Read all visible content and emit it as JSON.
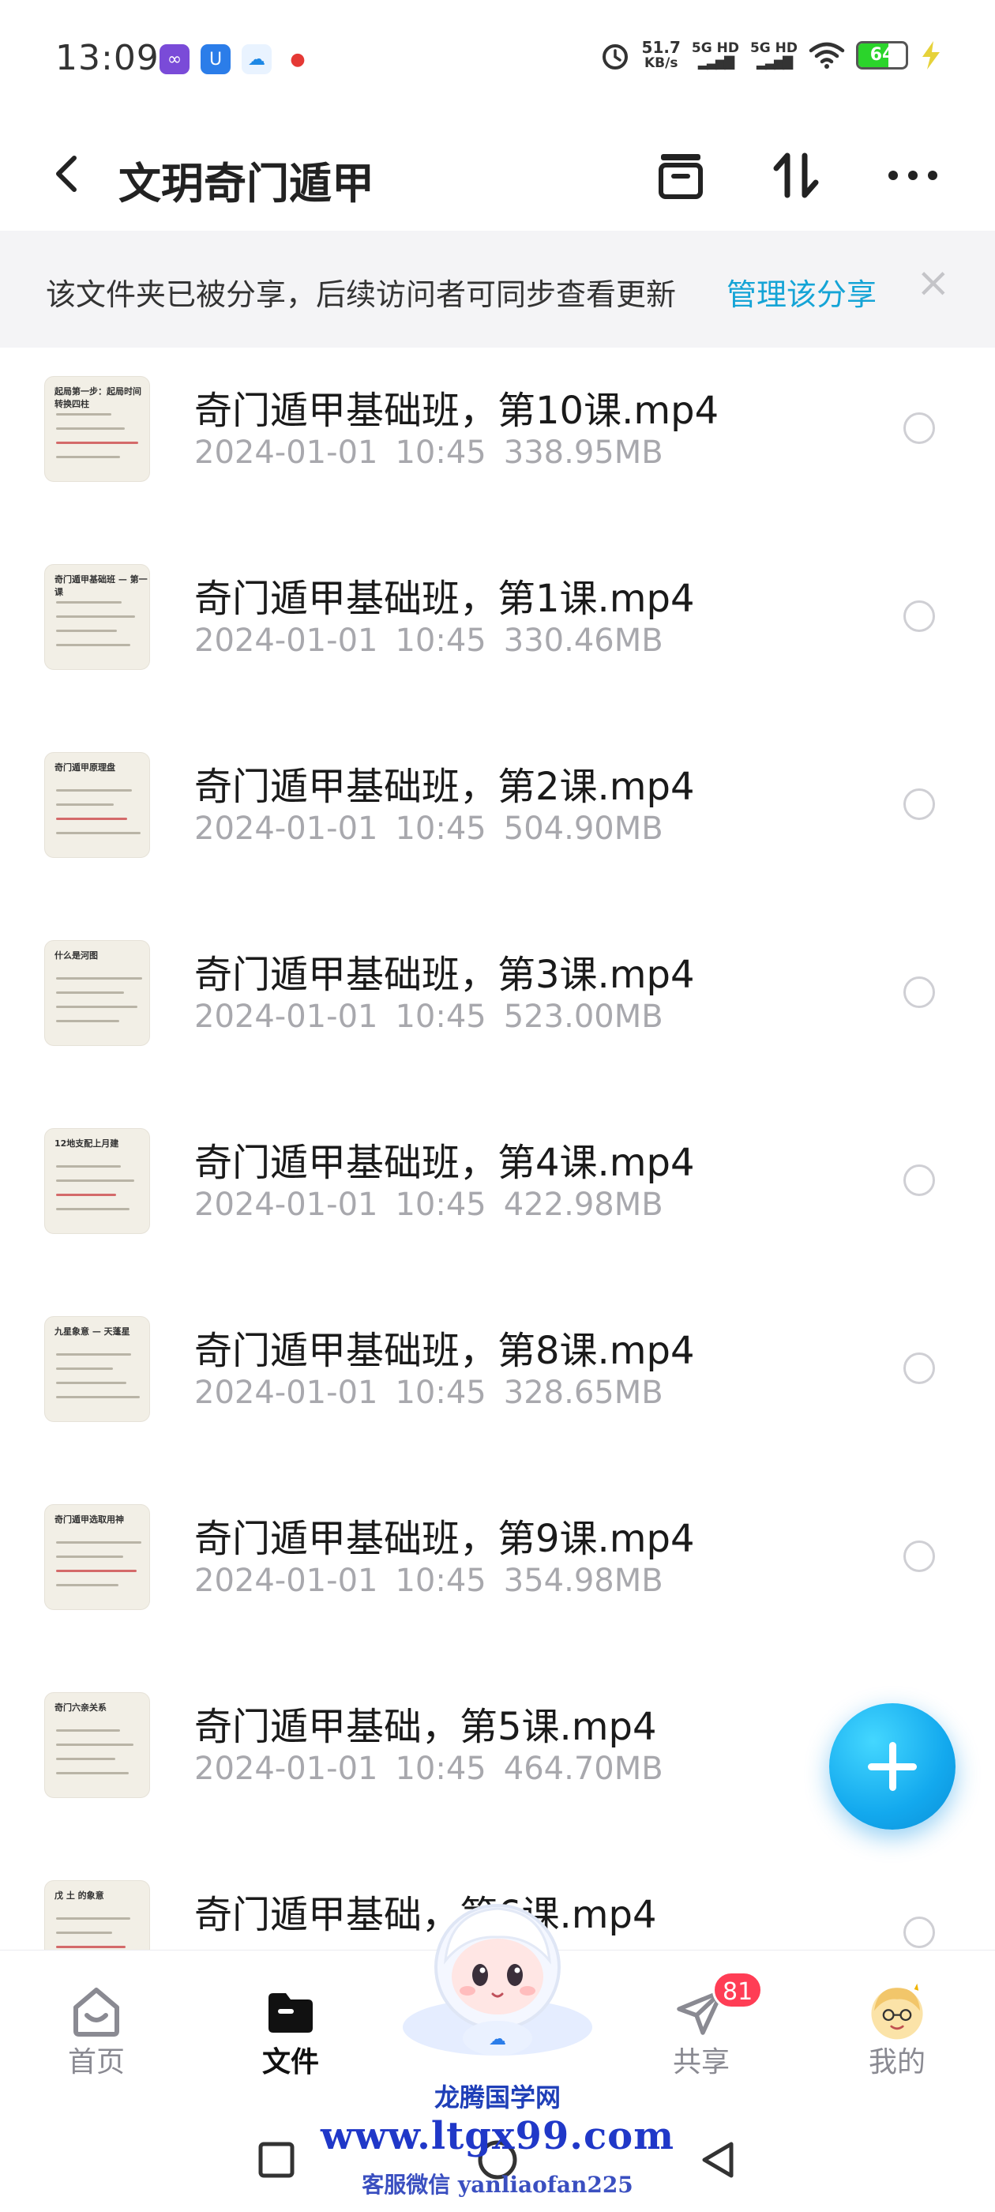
{
  "status_bar": {
    "time": "13:09",
    "net_speed_value": "51.7",
    "net_speed_unit": "KB/s",
    "signal_1": "5G HD",
    "signal_2": "5G HD",
    "battery": "64",
    "app_icons": [
      "infinity-app-icon",
      "shield-app-icon",
      "baidu-netdisk-icon",
      "map-pin-app-icon"
    ]
  },
  "header": {
    "title": "文玥奇门遁甲",
    "icons": [
      "back-icon",
      "archive-icon",
      "sort-icon",
      "more-icon"
    ]
  },
  "share_banner": {
    "text": "该文件夹已被分享，后续访问者可同步查看更新",
    "link": "管理该分享",
    "close": "×"
  },
  "files": [
    {
      "name": "奇门遁甲基础班，第10课.mp4",
      "date": "2024-01-01",
      "time": "10:45",
      "size": "338.95MB"
    },
    {
      "name": "奇门遁甲基础班，第1课.mp4",
      "date": "2024-01-01",
      "time": "10:45",
      "size": "330.46MB"
    },
    {
      "name": "奇门遁甲基础班，第2课.mp4",
      "date": "2024-01-01",
      "time": "10:45",
      "size": "504.90MB"
    },
    {
      "name": "奇门遁甲基础班，第3课.mp4",
      "date": "2024-01-01",
      "time": "10:45",
      "size": "523.00MB"
    },
    {
      "name": "奇门遁甲基础班，第4课.mp4",
      "date": "2024-01-01",
      "time": "10:45",
      "size": "422.98MB"
    },
    {
      "name": "奇门遁甲基础班，第8课.mp4",
      "date": "2024-01-01",
      "time": "10:45",
      "size": "328.65MB"
    },
    {
      "name": "奇门遁甲基础班，第9课.mp4",
      "date": "2024-01-01",
      "time": "10:45",
      "size": "354.98MB"
    },
    {
      "name": "奇门遁甲基础，第5课.mp4",
      "date": "2024-01-01",
      "time": "10:45",
      "size": "464.70MB"
    },
    {
      "name": "奇门遁甲基础，第6课.mp4",
      "date": "",
      "time": "",
      "size": ""
    }
  ],
  "thumb_titles": [
    "起局第一步：起局时间转换四柱",
    "奇门遁甲基础班 — 第一课",
    "奇门遁甲原理盘",
    "什么是河图",
    "12地支配上月建",
    "九星象意 — 天蓬星",
    "奇门遁甲选取用神",
    "奇门六亲关系",
    "戊 土 的象意"
  ],
  "fab": {
    "icon": "plus-icon"
  },
  "bottom_nav": [
    {
      "label": "首页",
      "icon": "home-icon",
      "active": false
    },
    {
      "label": "文件",
      "icon": "folder-icon",
      "active": true
    },
    {
      "label": "",
      "icon": "mascot-icon",
      "active": false
    },
    {
      "label": "共享",
      "icon": "paper-plane-icon",
      "active": false,
      "badge": "81"
    },
    {
      "label": "我的",
      "icon": "avatar-icon",
      "active": false
    }
  ],
  "watermark": {
    "line1": "龙腾国学网",
    "line2": "www.ltgx99.com",
    "line3": "客服微信 yanliaofan225"
  },
  "colors": {
    "accent": "#15a4d6",
    "badge": "#ff3d55",
    "fab": "#13a9ee"
  }
}
